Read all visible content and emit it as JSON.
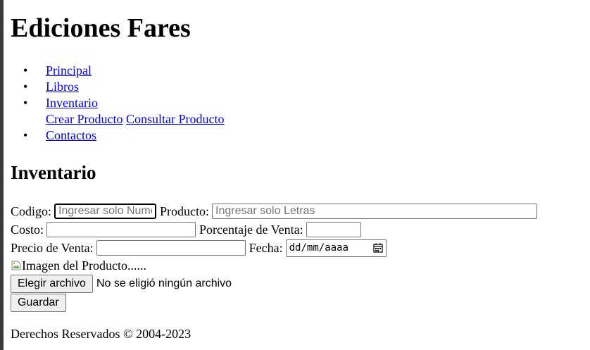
{
  "site": {
    "title": "Ediciones Fares"
  },
  "nav": {
    "bullet": "•",
    "principal": "Principal",
    "libros": "Libros",
    "inventario": "Inventario",
    "crear_producto": "Crear Producto",
    "consultar_producto": "Consultar Producto",
    "contactos": "Contactos"
  },
  "section": {
    "title": "Inventario"
  },
  "form": {
    "codigo_label": "Codigo:",
    "codigo_placeholder": "Ingresar solo Numeros",
    "producto_label": "Producto:",
    "producto_placeholder": "Ingresar solo Letras",
    "costo_label": "Costo:",
    "porcentaje_label": "Porcentaje de Venta:",
    "precio_label": "Precio de Venta:",
    "fecha_label": "Fecha:",
    "fecha_placeholder": "dd/mm/aaaa",
    "image_alt": "Imagen del Producto......",
    "file_button": "Elegir archivo",
    "file_status": "No se eligió ningún archivo",
    "save_button": "Guardar"
  },
  "footer": {
    "text": "Derechos Reservados © 2004-2023"
  }
}
